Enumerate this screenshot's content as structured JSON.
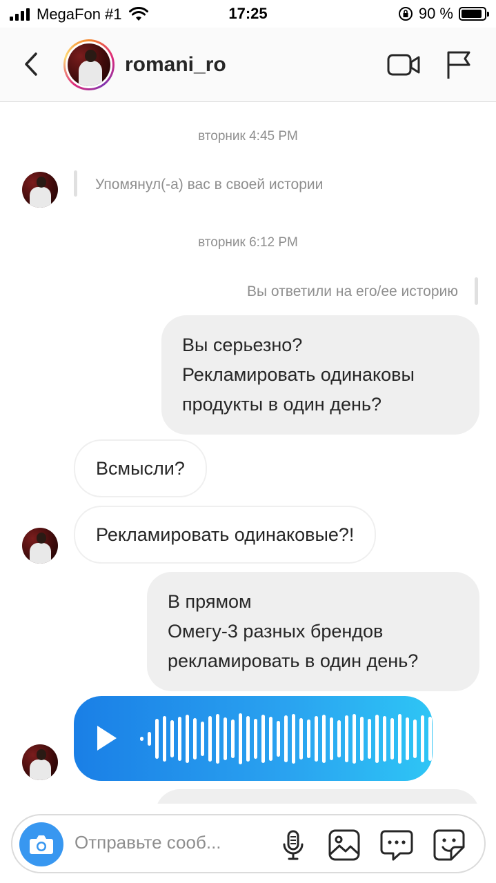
{
  "status_bar": {
    "carrier": "MegaFon #1",
    "time": "17:25",
    "battery_text": "90 %",
    "battery_level": 0.9
  },
  "header": {
    "username": "romani_ro"
  },
  "chat": {
    "timestamp_1": "вторник 4:45 PM",
    "mention_text": "Упомянул(-а) вас в своей истории",
    "timestamp_2": "вторник 6:12 PM",
    "reply_note": "Вы ответили на его/ее историю",
    "out_msg_1": [
      "Вы серьезно?",
      "Рекламировать одинаковы",
      "продукты в один день?"
    ],
    "in_msg_1": "Всмысли?",
    "in_msg_2": "Рекламировать одинаковые?!",
    "out_msg_2": [
      "В прямом",
      "Омегу-3 разных брендов",
      "рекламировать в один день?"
    ]
  },
  "composer": {
    "placeholder": "Отправьте сооб..."
  },
  "colors": {
    "accent": "#3897f0",
    "bubble_out": "#efefef",
    "voice_start": "#1a7fe6",
    "voice_end": "#2ec5f5"
  },
  "icons": [
    "back-chevron-icon",
    "video-call-icon",
    "flag-icon",
    "camera-icon",
    "microphone-icon",
    "gallery-icon",
    "chat-bubble-icon",
    "sticker-icon",
    "play-icon"
  ]
}
